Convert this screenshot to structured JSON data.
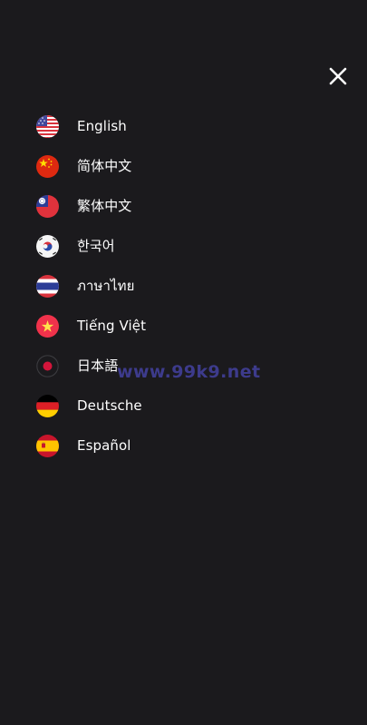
{
  "menu": {
    "close_icon": "close-icon",
    "languages": [
      {
        "label": "English",
        "flag": "flag-us-icon"
      },
      {
        "label": "简体中文",
        "flag": "flag-cn-icon"
      },
      {
        "label": "繁体中文",
        "flag": "flag-tw-icon"
      },
      {
        "label": "한국어",
        "flag": "flag-kr-icon"
      },
      {
        "label": "ภาษาไทย",
        "flag": "flag-th-icon"
      },
      {
        "label": "Tiếng Việt",
        "flag": "flag-vn-icon"
      },
      {
        "label": "日本語",
        "flag": "flag-jp-icon"
      },
      {
        "label": "Deutsche",
        "flag": "flag-de-icon"
      },
      {
        "label": "Español",
        "flag": "flag-es-icon"
      }
    ]
  },
  "watermark": {
    "text": "www.99k9.net"
  },
  "colors": {
    "background": "#1b1a1d",
    "text": "#ffffff",
    "watermark": "#3d3b8c"
  }
}
